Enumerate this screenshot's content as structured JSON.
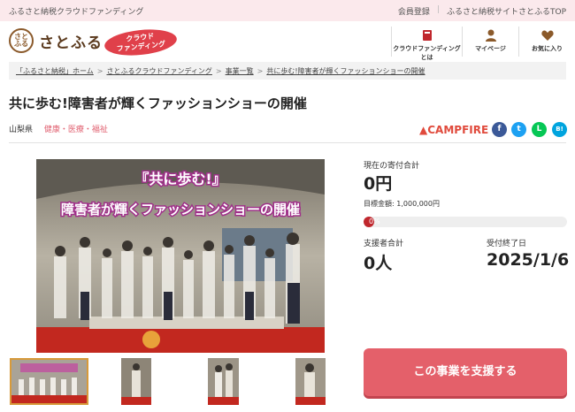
{
  "topbar": {
    "site_name": "ふるさと納税クラウドファンディング",
    "register": "会員登録",
    "top_link": "ふるさと納税サイトさとふるTOP"
  },
  "header": {
    "logo_mark": "さと ふる",
    "logo_text": "さとふる",
    "badge_line1": "クラウド",
    "badge_line2": "ファンディング",
    "nav": [
      {
        "label": "クラウドファンディングとは",
        "icon": "book-icon"
      },
      {
        "label": "マイページ",
        "icon": "user-icon"
      },
      {
        "label": "お気に入り",
        "icon": "heart-icon"
      }
    ]
  },
  "breadcrumb": {
    "items": [
      "「ふるさと納税」ホーム",
      "さとふるクラウドファンディング",
      "事業一覧",
      "共に歩む!障害者が輝くファッションショーの開催"
    ]
  },
  "project": {
    "title": "共に歩む!障害者が輝くファッションショーの開催",
    "prefecture": "山梨県",
    "category": "健康・医療・福祉",
    "platform": "CAMPFIRE",
    "share": [
      {
        "icon": "facebook-icon",
        "glyph": "f",
        "color": "#3b5998"
      },
      {
        "icon": "twitter-icon",
        "glyph": "t",
        "color": "#1da1f2"
      },
      {
        "icon": "line-icon",
        "glyph": "L",
        "color": "#06c755"
      },
      {
        "icon": "hatena-icon",
        "glyph": "B!",
        "color": "#00a4de"
      }
    ],
    "banner_line1": "『共に歩む!』",
    "banner_line2": "障害者が輝くファッションショーの開催"
  },
  "stats": {
    "current_label": "現在の寄付合計",
    "current_value": "0円",
    "goal_label": "目標金額",
    "goal_value": "1,000,000円",
    "progress_text": "0%",
    "progress_value": 0,
    "supporters_label": "支援者合計",
    "supporters_value": "0人",
    "end_label": "受付終了日",
    "end_value": "2025/1/6"
  },
  "cta": {
    "label": "この事業を支援する"
  },
  "colors": {
    "accent": "#e4606a",
    "topbar": "#fbe9ec",
    "brand_red": "#e0404a"
  }
}
